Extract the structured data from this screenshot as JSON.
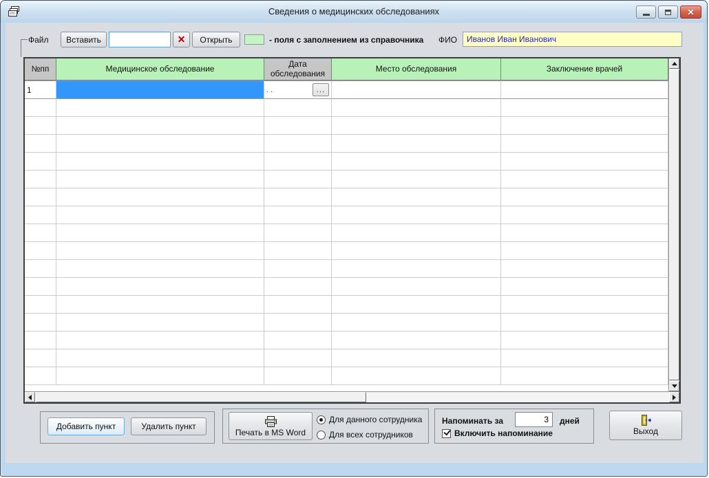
{
  "window": {
    "title": "Сведения о медицинских обследованиях",
    "close_glyph": "✕"
  },
  "toolbar": {
    "file_group_label": "Файл",
    "paste_button": "Вставить",
    "file_input_value": "",
    "clear_button": "✕",
    "open_button": "Открыть",
    "legend_text": "- поля с заполнением из справочника",
    "fio_label": "ФИО",
    "fio_value": "Иванов Иван Иванович"
  },
  "table": {
    "columns": [
      {
        "label": "№пп",
        "style": "gray"
      },
      {
        "label": "Медицинское обследование",
        "style": "green"
      },
      {
        "label": "Дата обследования",
        "style": "gray"
      },
      {
        "label": "Место обследования",
        "style": "green"
      },
      {
        "label": "Заключение врачей",
        "style": "green"
      }
    ],
    "rows": [
      {
        "num": "1",
        "exam": "",
        "date": ".  .",
        "date_button": "...",
        "place": "",
        "conclusion": ""
      }
    ],
    "empty_row_count": 16
  },
  "footer": {
    "add_label": "Добавить пункт",
    "delete_label": "Удалить пункт",
    "print_label": "Печать в MS Word",
    "scope_options": [
      {
        "label": "Для данного сотрудника",
        "selected": true
      },
      {
        "label": "Для всех сотрудников",
        "selected": false
      }
    ],
    "remind_label": "Напоминать за",
    "remind_value": "3",
    "remind_units": "дней",
    "reminder_checkbox_label": "Включить напоминание",
    "reminder_checked": true,
    "exit_label": "Выход"
  },
  "colors": {
    "selection_blue": "#3296fa",
    "header_green": "#b9f2b9",
    "header_gray": "#c6c6c6",
    "fio_bg": "#ffffc6",
    "fio_text": "#2424d0",
    "clear_red": "#b40000"
  }
}
